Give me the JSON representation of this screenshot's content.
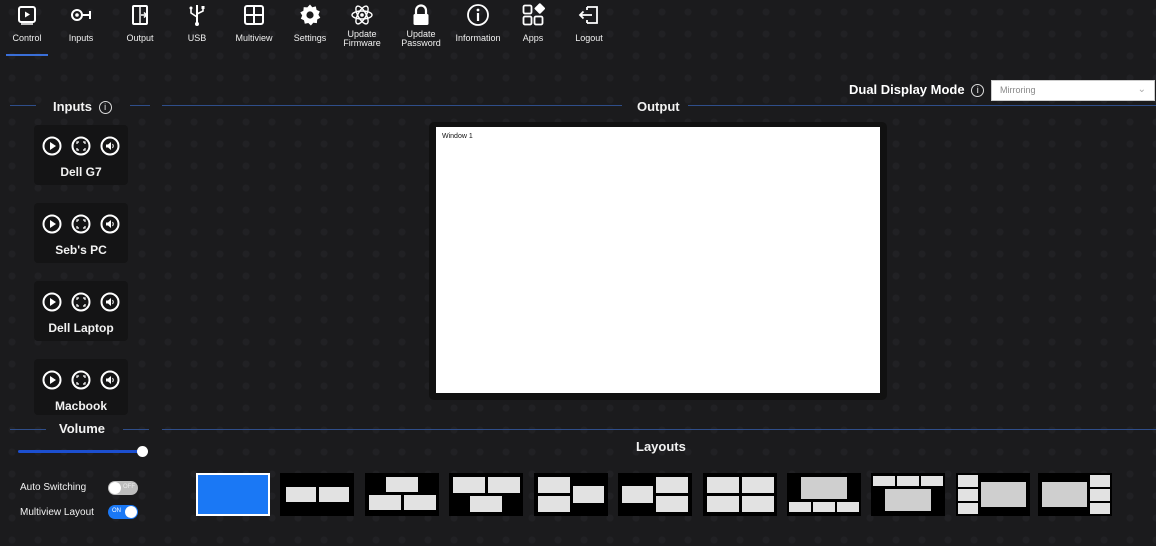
{
  "nav": {
    "items": [
      {
        "label": "Control",
        "icon": "play-screen-icon"
      },
      {
        "label": "Inputs",
        "icon": "input-plug-icon"
      },
      {
        "label": "Output",
        "icon": "output-arrow-icon"
      },
      {
        "label": "USB",
        "icon": "usb-icon"
      },
      {
        "label": "Multiview",
        "icon": "grid-icon"
      },
      {
        "label": "Settings",
        "icon": "gear-icon"
      },
      {
        "label": "Update\nFirmware",
        "icon": "atom-icon"
      },
      {
        "label": "Update\nPassword",
        "icon": "lock-icon"
      },
      {
        "label": "Information",
        "icon": "info-icon"
      },
      {
        "label": "Apps",
        "icon": "apps-icon"
      },
      {
        "label": "Logout",
        "icon": "logout-icon"
      }
    ],
    "active": "Control"
  },
  "inputs": {
    "title": "Inputs",
    "cards": [
      {
        "name": "Dell G7"
      },
      {
        "name": "Seb's PC"
      },
      {
        "name": "Dell Laptop"
      },
      {
        "name": "Macbook"
      }
    ]
  },
  "output": {
    "title": "Output",
    "window_label": "Window 1"
  },
  "dual_display": {
    "label": "Dual Display Mode",
    "value": "Mirroring"
  },
  "volume": {
    "title": "Volume",
    "level": 1.0
  },
  "toggles": {
    "auto_switching": {
      "label": "Auto Switching",
      "state": "off",
      "state_text": "OFF"
    },
    "multiview_layout": {
      "label": "Multiview Layout",
      "state": "on",
      "state_text": "ON"
    }
  },
  "layouts": {
    "title": "Layouts",
    "selected_index": 0
  },
  "colors": {
    "accent": "#1a78f5",
    "section_line": "#2f4e8a",
    "background": "#1b1b1d"
  }
}
